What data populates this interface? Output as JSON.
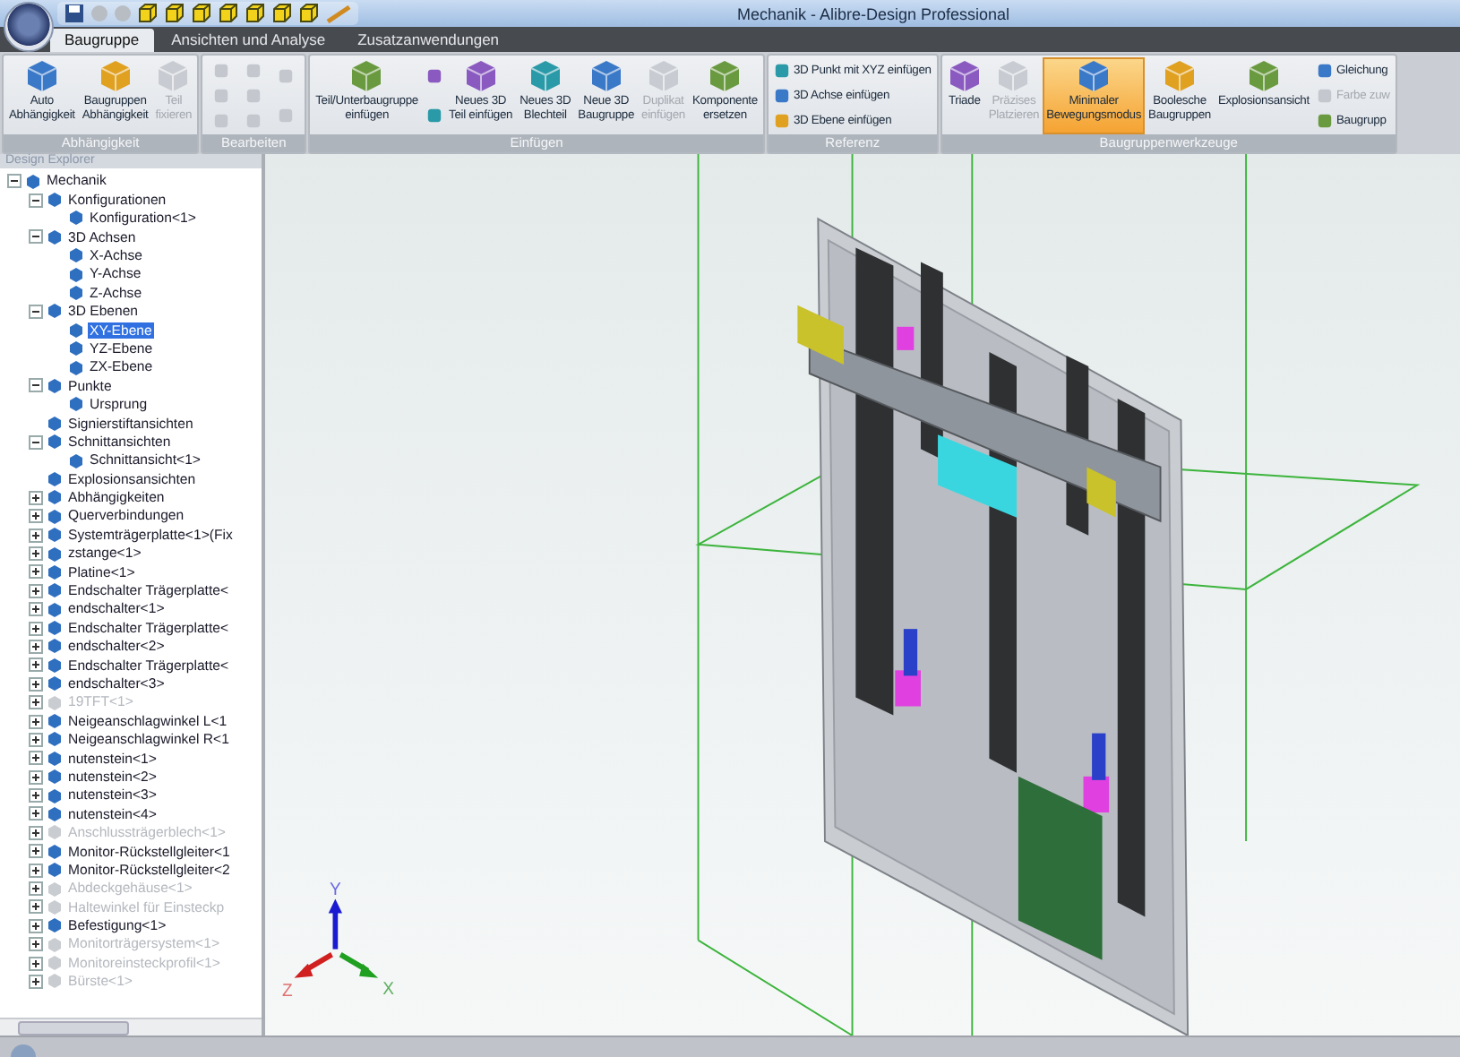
{
  "window": {
    "title": "Mechanik - Alibre-Design Professional"
  },
  "tabs": [
    {
      "label": "Baugruppe",
      "selected": true
    },
    {
      "label": "Ansichten und Analyse",
      "selected": false
    },
    {
      "label": "Zusatzanwendungen",
      "selected": false
    }
  ],
  "ribbon": [
    {
      "label": "Abhängigkeit",
      "columns": [
        {
          "kind": "large",
          "label": "Auto\nAbhängigkeit",
          "disabled": false,
          "on": false
        },
        {
          "kind": "large",
          "label": "Baugruppen\nAbhängigkeit",
          "disabled": false,
          "on": false
        },
        {
          "kind": "large",
          "label": "Teil\nfixieren",
          "disabled": true,
          "on": false
        }
      ]
    },
    {
      "label": "Bearbeiten",
      "columns": [
        {
          "kind": "stack",
          "items": [
            {
              "disabled": true
            },
            {
              "disabled": true
            },
            {
              "disabled": true
            }
          ]
        },
        {
          "kind": "stack",
          "items": [
            {
              "disabled": true
            },
            {
              "disabled": true
            },
            {
              "disabled": true
            }
          ]
        },
        {
          "kind": "stack",
          "items": [
            {
              "disabled": true
            },
            {
              "disabled": true
            }
          ]
        }
      ]
    },
    {
      "label": "Einfügen",
      "columns": [
        {
          "kind": "large",
          "label": "Teil/Unterbaugruppe\neinfügen",
          "disabled": false,
          "on": false
        },
        {
          "kind": "stack",
          "items": [
            {
              "disabled": false
            },
            {
              "disabled": false
            }
          ]
        },
        {
          "kind": "large",
          "label": "Neues 3D\nTeil einfügen",
          "disabled": false,
          "on": false
        },
        {
          "kind": "large",
          "label": "Neues 3D\nBlechteil",
          "disabled": false,
          "on": false
        },
        {
          "kind": "large",
          "label": "Neue 3D\nBaugruppe",
          "disabled": false,
          "on": false
        },
        {
          "kind": "large",
          "label": "Duplikat\neinfügen",
          "disabled": true,
          "on": false
        },
        {
          "kind": "large",
          "label": "Komponente\nersetzen",
          "disabled": false,
          "on": false
        }
      ]
    },
    {
      "label": "Referenz",
      "columns": [
        {
          "kind": "stack",
          "items": [
            {
              "label": "3D Punkt mit XYZ einfügen",
              "disabled": false
            },
            {
              "label": "3D Achse einfügen",
              "disabled": false
            },
            {
              "label": "3D Ebene einfügen",
              "disabled": false
            }
          ]
        }
      ]
    },
    {
      "label": "Baugruppenwerkzeuge",
      "columns": [
        {
          "kind": "large",
          "label": "Triade",
          "disabled": false,
          "on": false
        },
        {
          "kind": "large",
          "label": "Präzises\nPlatzieren",
          "disabled": true,
          "on": false
        },
        {
          "kind": "large",
          "label": "Minimaler\nBewegungsmodus",
          "disabled": false,
          "on": true
        },
        {
          "kind": "large",
          "label": "Boolesche\nBaugruppen",
          "disabled": false,
          "on": false
        },
        {
          "kind": "large",
          "label": "Explosionsansicht",
          "disabled": false,
          "on": false
        },
        {
          "kind": "stack",
          "items": [
            {
              "label": "Gleichung",
              "disabled": false
            },
            {
              "label": "Farbe zuw",
              "disabled": true
            },
            {
              "label": "Baugrupp",
              "disabled": false
            }
          ]
        }
      ]
    }
  ],
  "explorer": {
    "title": "Design Explorer",
    "tree": [
      {
        "label": "Mechanik",
        "expanded": true,
        "selected": false,
        "disabled": false,
        "children": [
          {
            "label": "Konfigurationen",
            "expanded": true,
            "selected": false,
            "disabled": false,
            "children": [
              {
                "label": "Konfiguration<1>",
                "selected": false,
                "disabled": false
              }
            ]
          },
          {
            "label": "3D Achsen",
            "expanded": true,
            "selected": false,
            "disabled": false,
            "children": [
              {
                "label": "X-Achse",
                "selected": false,
                "disabled": false
              },
              {
                "label": "Y-Achse",
                "selected": false,
                "disabled": false
              },
              {
                "label": "Z-Achse",
                "selected": false,
                "disabled": false
              }
            ]
          },
          {
            "label": "3D Ebenen",
            "expanded": true,
            "selected": false,
            "disabled": false,
            "children": [
              {
                "label": "XY-Ebene",
                "selected": true,
                "disabled": false
              },
              {
                "label": "YZ-Ebene",
                "selected": false,
                "disabled": false
              },
              {
                "label": "ZX-Ebene",
                "selected": false,
                "disabled": false
              }
            ]
          },
          {
            "label": "Punkte",
            "expanded": true,
            "selected": false,
            "disabled": false,
            "children": [
              {
                "label": "Ursprung",
                "selected": false,
                "disabled": false
              }
            ]
          },
          {
            "label": "Signierstiftansichten",
            "selected": false,
            "disabled": false
          },
          {
            "label": "Schnittansichten",
            "expanded": true,
            "selected": false,
            "disabled": false,
            "children": [
              {
                "label": "Schnittansicht<1>",
                "selected": false,
                "disabled": false
              }
            ]
          },
          {
            "label": "Explosionsansichten",
            "selected": false,
            "disabled": false
          },
          {
            "label": "Abhängigkeiten",
            "expanded": false,
            "selected": false,
            "disabled": false
          },
          {
            "label": "Querverbindungen",
            "expanded": false,
            "selected": false,
            "disabled": false
          },
          {
            "label": "Systemträgerplatte<1>(Fix",
            "expanded": false,
            "selected": false,
            "disabled": false
          },
          {
            "label": "zstange<1>",
            "expanded": false,
            "selected": false,
            "disabled": false
          },
          {
            "label": "Platine<1>",
            "expanded": false,
            "selected": false,
            "disabled": false
          },
          {
            "label": "Endschalter Trägerplatte<",
            "expanded": false,
            "selected": false,
            "disabled": false
          },
          {
            "label": "endschalter<1>",
            "expanded": false,
            "selected": false,
            "disabled": false
          },
          {
            "label": "Endschalter Trägerplatte<",
            "expanded": false,
            "selected": false,
            "disabled": false
          },
          {
            "label": "endschalter<2>",
            "expanded": false,
            "selected": false,
            "disabled": false
          },
          {
            "label": "Endschalter Trägerplatte<",
            "expanded": false,
            "selected": false,
            "disabled": false
          },
          {
            "label": "endschalter<3>",
            "expanded": false,
            "selected": false,
            "disabled": false
          },
          {
            "label": "19TFT<1>",
            "expanded": false,
            "selected": false,
            "disabled": true
          },
          {
            "label": "Neigeanschlagwinkel L<1",
            "expanded": false,
            "selected": false,
            "disabled": false
          },
          {
            "label": "Neigeanschlagwinkel R<1",
            "expanded": false,
            "selected": false,
            "disabled": false
          },
          {
            "label": "nutenstein<1>",
            "expanded": false,
            "selected": false,
            "disabled": false
          },
          {
            "label": "nutenstein<2>",
            "expanded": false,
            "selected": false,
            "disabled": false
          },
          {
            "label": "nutenstein<3>",
            "expanded": false,
            "selected": false,
            "disabled": false
          },
          {
            "label": "nutenstein<4>",
            "expanded": false,
            "selected": false,
            "disabled": false
          },
          {
            "label": "Anschlussträgerblech<1>",
            "expanded": false,
            "selected": false,
            "disabled": true
          },
          {
            "label": "Monitor-Rückstellgleiter<1",
            "expanded": false,
            "selected": false,
            "disabled": false
          },
          {
            "label": "Monitor-Rückstellgleiter<2",
            "expanded": false,
            "selected": false,
            "disabled": false
          },
          {
            "label": "Abdeckgehäuse<1>",
            "expanded": false,
            "selected": false,
            "disabled": true
          },
          {
            "label": "Haltewinkel für Einsteckp",
            "expanded": false,
            "selected": false,
            "disabled": true
          },
          {
            "label": "Befestigung<1>",
            "expanded": false,
            "selected": false,
            "disabled": false
          },
          {
            "label": "Monitorträgersystem<1>",
            "expanded": false,
            "selected": false,
            "disabled": true
          },
          {
            "label": "Monitoreinsteckprofil<1>",
            "expanded": false,
            "selected": false,
            "disabled": true
          },
          {
            "label": "Bürste<1>",
            "expanded": false,
            "selected": false,
            "disabled": true
          }
        ]
      }
    ]
  },
  "triad": {
    "x": "X",
    "y": "Y",
    "z": "Z"
  }
}
